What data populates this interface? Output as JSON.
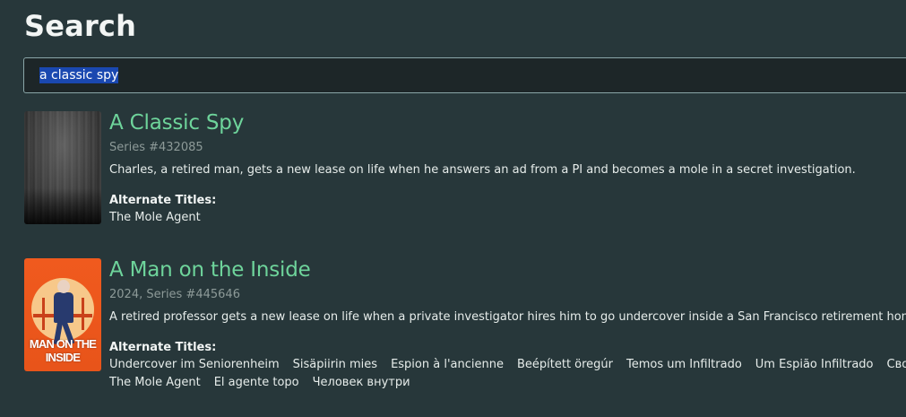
{
  "page": {
    "title": "Search"
  },
  "search": {
    "query": "a classic spy"
  },
  "results": [
    {
      "title": "A Classic Spy",
      "meta": "Series #432085",
      "description": "Charles, a retired man, gets a new lease on life when he answers an ad from a PI and becomes a mole in a secret investigation.",
      "alt_label": "Alternate Titles:",
      "alt_titles_row1": [
        "The Mole Agent"
      ],
      "alt_titles_row2": []
    },
    {
      "title": "A Man on the Inside",
      "meta": "2024, Series #445646",
      "description": "A retired professor gets a new lease on life when a private investigator hires him to go undercover inside a San Francisco retirement home.",
      "poster_caption": "MAN ON THE INSIDE",
      "alt_label": "Alternate Titles:",
      "alt_titles_row1": [
        "Undercover im Seniorenheim",
        "Sisäpiirin mies",
        "Espion à l'ancienne",
        "Beépített öregúr",
        "Temos um Infiltrado",
        "Um Espião Infiltrado",
        "Сво"
      ],
      "alt_titles_row2": [
        "The Mole Agent",
        "El agente topo",
        "Человек внутри"
      ]
    }
  ],
  "colors": {
    "background": "#27373a",
    "title_green": "#6ed49b",
    "selection_blue": "#1a48b0"
  }
}
